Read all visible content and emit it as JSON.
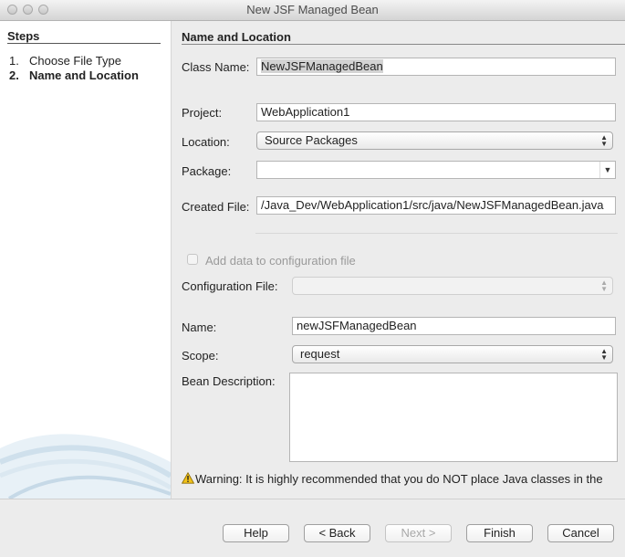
{
  "window": {
    "title": "New JSF Managed Bean"
  },
  "steps": {
    "heading": "Steps",
    "items": [
      {
        "num": "1.",
        "label": "Choose File Type"
      },
      {
        "num": "2.",
        "label": "Name and Location"
      }
    ]
  },
  "form": {
    "section_title": "Name and Location",
    "class_name": {
      "label": "Class Name:",
      "value": "NewJSFManagedBean"
    },
    "project": {
      "label": "Project:",
      "value": "WebApplication1"
    },
    "location": {
      "label": "Location:",
      "value": "Source Packages"
    },
    "package": {
      "label": "Package:",
      "value": ""
    },
    "created_file": {
      "label": "Created File:",
      "value": "/Java_Dev/WebApplication1/src/java/NewJSFManagedBean.java"
    },
    "add_config": {
      "label": "Add data to configuration file",
      "checked": false
    },
    "config_file": {
      "label": "Configuration File:",
      "value": ""
    },
    "name": {
      "label": "Name:",
      "value": "newJSFManagedBean"
    },
    "scope": {
      "label": "Scope:",
      "value": "request"
    },
    "bean_description": {
      "label": "Bean Description:",
      "value": ""
    },
    "warning": "Warning: It is highly recommended that you do NOT place Java classes in the"
  },
  "buttons": {
    "help": "Help",
    "back": "< Back",
    "next": "Next >",
    "finish": "Finish",
    "cancel": "Cancel"
  }
}
